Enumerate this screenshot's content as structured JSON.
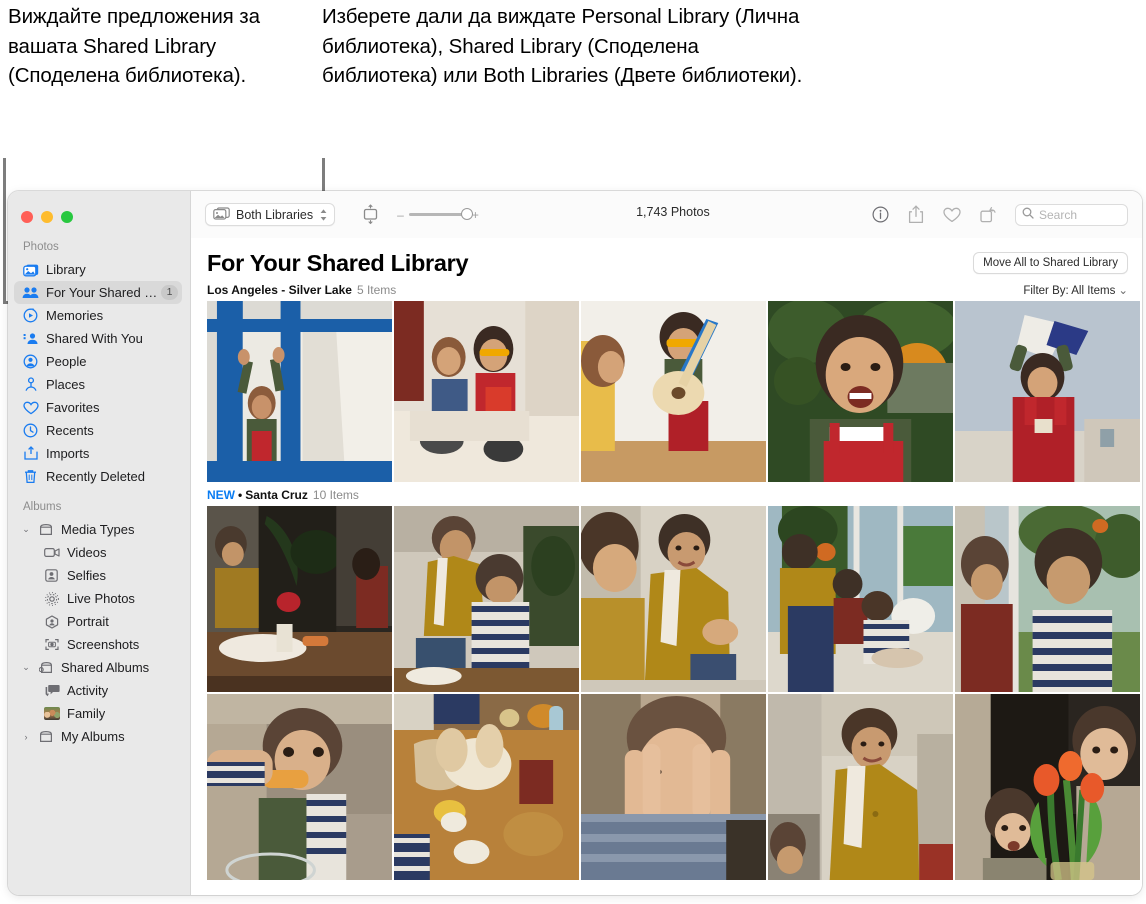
{
  "annotations": {
    "left": "Виждайте предложения за вашата Shared Library (Споделена библиотека).",
    "right": "Изберете дали да виждате Personal Library (Лична библиотека), Shared Library (Споделена библиотека) или Both Libraries (Двете библиотеки)."
  },
  "window": {
    "traffic_lights": [
      "close",
      "minimize",
      "zoom"
    ],
    "colors": {
      "accent": "#1a7cf0",
      "new_badge": "#0a7cf2",
      "sidebar_bg": "#e9e9e9",
      "selected_row": "#d9d9d9"
    }
  },
  "sidebar": {
    "sections": [
      {
        "header": "Photos",
        "items": [
          {
            "label": "Library",
            "icon": "photos-library-icon",
            "selected": false,
            "badge": ""
          },
          {
            "label": "For Your Shared Library",
            "icon": "people-two-icon",
            "selected": true,
            "badge": "1"
          },
          {
            "label": "Memories",
            "icon": "memories-play-icon",
            "selected": false,
            "badge": ""
          },
          {
            "label": "Shared With You",
            "icon": "shared-with-you-icon",
            "selected": false,
            "badge": ""
          },
          {
            "label": "People",
            "icon": "person-circle-icon",
            "selected": false,
            "badge": ""
          },
          {
            "label": "Places",
            "icon": "map-pin-icon",
            "selected": false,
            "badge": ""
          },
          {
            "label": "Favorites",
            "icon": "heart-icon",
            "selected": false,
            "badge": ""
          },
          {
            "label": "Recents",
            "icon": "clock-icon",
            "selected": false,
            "badge": ""
          },
          {
            "label": "Imports",
            "icon": "import-arrow-icon",
            "selected": false,
            "badge": ""
          },
          {
            "label": "Recently Deleted",
            "icon": "trash-icon",
            "selected": false,
            "badge": ""
          }
        ]
      },
      {
        "header": "Albums",
        "items": [
          {
            "label": "Media Types",
            "icon": "album-box-icon",
            "disclosure": "expanded",
            "level": 0
          },
          {
            "label": "Videos",
            "icon": "video-camera-icon",
            "disclosure": "",
            "level": 1
          },
          {
            "label": "Selfies",
            "icon": "selfie-icon",
            "disclosure": "",
            "level": 1
          },
          {
            "label": "Live Photos",
            "icon": "live-photo-icon",
            "disclosure": "",
            "level": 1
          },
          {
            "label": "Portrait",
            "icon": "portrait-icon",
            "disclosure": "",
            "level": 1
          },
          {
            "label": "Screenshots",
            "icon": "screenshot-icon",
            "disclosure": "",
            "level": 1
          },
          {
            "label": "Shared Albums",
            "icon": "shared-album-icon",
            "disclosure": "expanded",
            "level": 0
          },
          {
            "label": "Activity",
            "icon": "activity-bubble-icon",
            "disclosure": "",
            "level": 1
          },
          {
            "label": "Family",
            "icon": "family-thumbnail",
            "disclosure": "",
            "level": 1
          },
          {
            "label": "My Albums",
            "icon": "album-box-icon",
            "disclosure": "collapsed",
            "level": 0
          }
        ]
      }
    ]
  },
  "toolbar": {
    "library_filter_label": "Both Libraries",
    "library_filter_icon": "photos-stack-icon",
    "aspect_icon": "aspect-ratio-icon",
    "zoom_minus": "–",
    "zoom_plus": "+",
    "zoom_value": 100,
    "photo_count": "1,743 Photos",
    "actions": [
      {
        "name": "info-icon",
        "glyph": "ⓘ"
      },
      {
        "name": "share-icon",
        "glyph": "share"
      },
      {
        "name": "favorite-heart-icon",
        "glyph": "heart"
      },
      {
        "name": "rotate-icon",
        "glyph": "rotate"
      }
    ],
    "search": {
      "placeholder": "Search",
      "value": "",
      "icon": "search-icon"
    }
  },
  "content": {
    "page_title": "For Your Shared Library",
    "move_all_button": "Move All to Shared Library",
    "filter_label": "Filter By: All Items",
    "groups": [
      {
        "new_badge": "",
        "separator": "",
        "title": "Los Angeles - Silver Lake",
        "count": "5 Items",
        "rows": [
          [
            {
              "name": "photo-child-at-blue-window"
            },
            {
              "name": "photo-two-kids-on-bed"
            },
            {
              "name": "photo-child-playing-guitar"
            },
            {
              "name": "photo-laughing-child-outdoors"
            },
            {
              "name": "photo-child-with-paper-megaphone"
            }
          ]
        ]
      },
      {
        "new_badge": "NEW",
        "separator": "•",
        "title": "Santa Cruz",
        "count": "10 Items",
        "rows": [
          [
            {
              "name": "photo-kitchen-table-baking"
            },
            {
              "name": "photo-mother-and-child-baking"
            },
            {
              "name": "photo-mother-laughing-flour"
            },
            {
              "name": "photo-family-by-the-window"
            },
            {
              "name": "photo-two-boys-at-window"
            }
          ],
          [
            {
              "name": "photo-child-drinking-juice"
            },
            {
              "name": "photo-hands-kneading-dough"
            },
            {
              "name": "photo-child-floury-face"
            },
            {
              "name": "photo-mother-smiling-kitchen"
            },
            {
              "name": "photo-baby-with-tulips"
            }
          ]
        ]
      }
    ]
  }
}
